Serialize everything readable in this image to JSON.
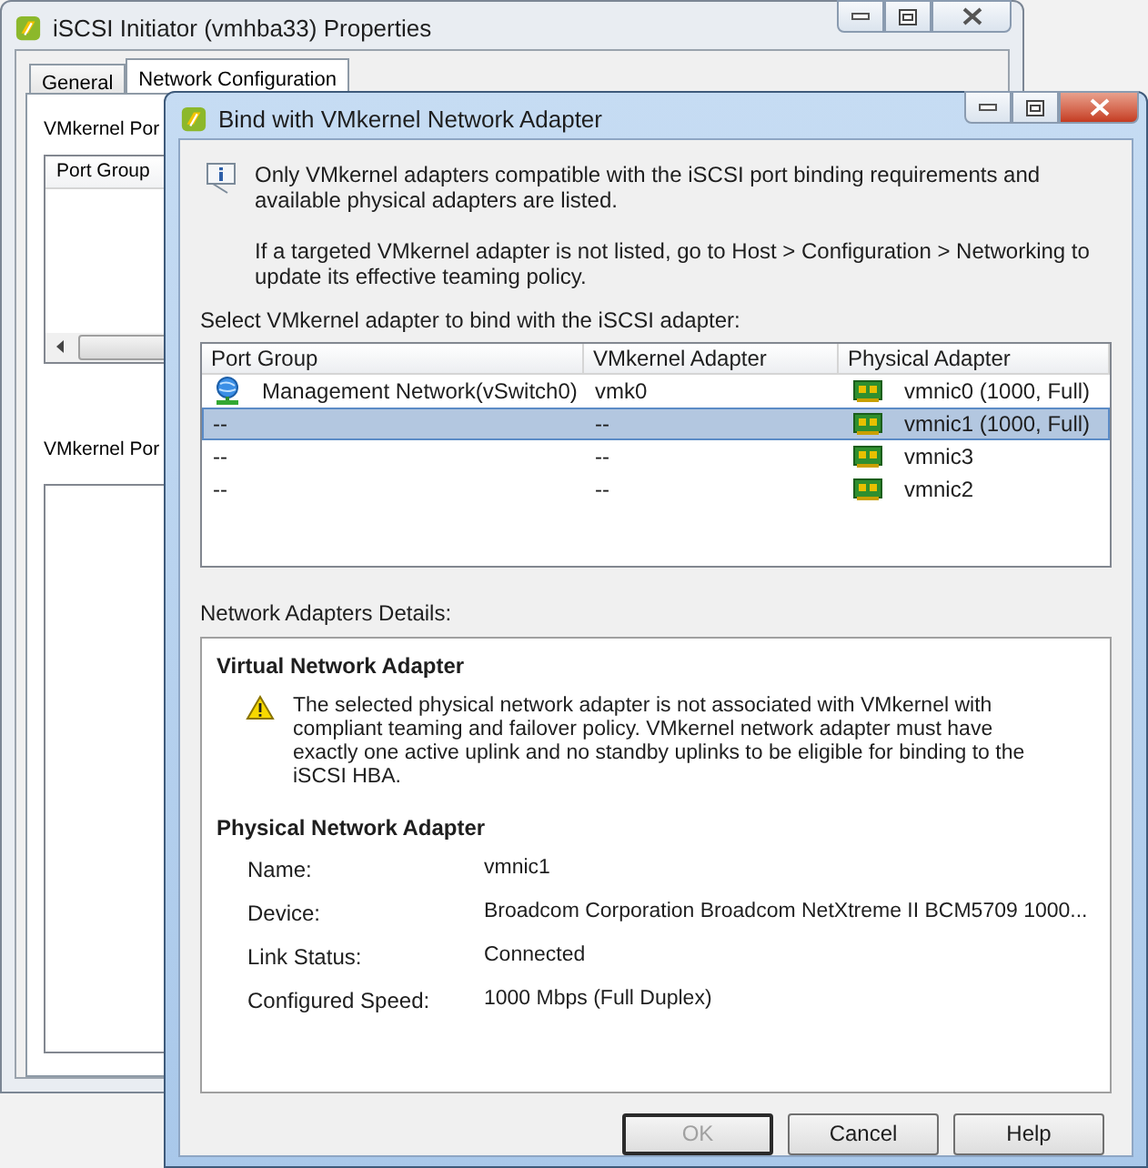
{
  "background_window": {
    "title": "iSCSI Initiator (vmhba33) Properties",
    "tabs": [
      {
        "label": "General",
        "selected": false
      },
      {
        "label": "Network Configuration",
        "selected": true
      }
    ],
    "section_1_label": "VMkernel Por",
    "list_column": "Port Group",
    "section_2_label": "VMkernel Por"
  },
  "dialog": {
    "title": "Bind with VMkernel Network Adapter",
    "info": [
      "Only VMkernel adapters compatible with the iSCSI port binding requirements and available physical adapters are listed.",
      "If a targeted VMkernel adapter is not listed, go to Host > Configuration > Networking to update its effective teaming policy."
    ],
    "list_label": "Select VMkernel adapter to bind with the iSCSI adapter:",
    "table": {
      "columns": [
        "Port Group",
        "VMkernel Adapter",
        "Physical Adapter"
      ],
      "rows": [
        {
          "kind": "network",
          "port_group": "Management Network(vSwitch0)",
          "vmkernel_adapter": "vmk0",
          "physical_adapter": "vmnic0 (1000, Full)",
          "selected": false
        },
        {
          "kind": "plain",
          "port_group": "--",
          "vmkernel_adapter": "--",
          "physical_adapter": "vmnic1 (1000, Full)",
          "selected": true
        },
        {
          "kind": "plain",
          "port_group": "--",
          "vmkernel_adapter": "--",
          "physical_adapter": "vmnic3",
          "selected": false
        },
        {
          "kind": "plain",
          "port_group": "--",
          "vmkernel_adapter": "--",
          "physical_adapter": "vmnic2",
          "selected": false
        }
      ]
    },
    "details_label": "Network Adapters Details:",
    "details": {
      "virtual_heading": "Virtual Network Adapter",
      "warning": "The selected physical network adapter is not associated with VMkernel with compliant teaming and failover policy. VMkernel network adapter must have exactly one active uplink and no standby uplinks to be eligible for binding to the iSCSI HBA.",
      "physical_heading": "Physical Network Adapter",
      "fields": [
        {
          "label": "Name:",
          "value": "vmnic1"
        },
        {
          "label": "Device:",
          "value": "Broadcom Corporation Broadcom NetXtreme II BCM5709 1000..."
        },
        {
          "label": "Link Status:",
          "value": "Connected"
        },
        {
          "label": "Configured Speed:",
          "value": "1000 Mbps (Full Duplex)"
        }
      ]
    },
    "buttons": [
      {
        "label": "OK",
        "disabled": true
      },
      {
        "label": "Cancel",
        "disabled": false
      },
      {
        "label": "Help",
        "disabled": false
      }
    ]
  }
}
